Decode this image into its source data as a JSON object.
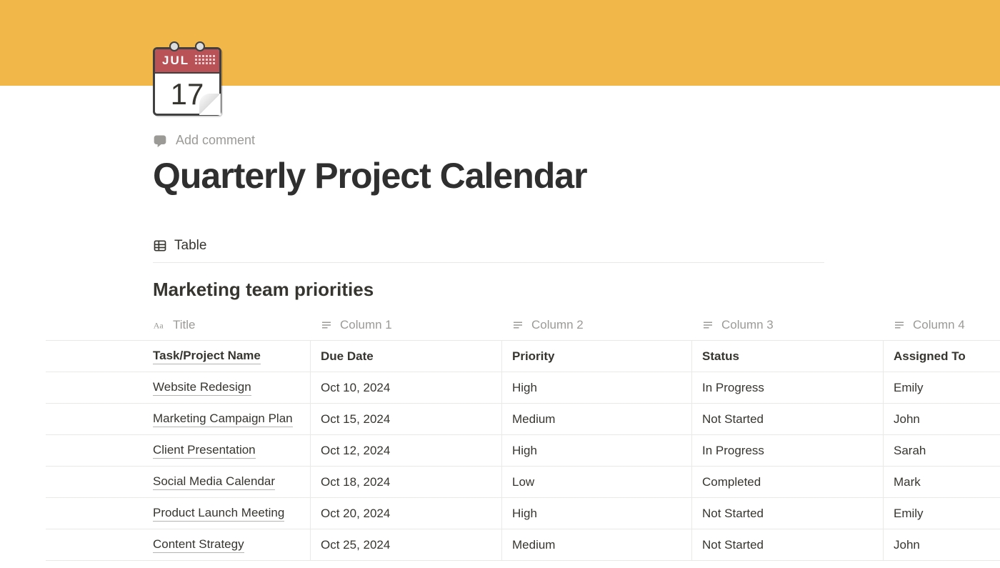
{
  "banner": {
    "color": "#f2b749"
  },
  "page_icon": {
    "month": "JUL",
    "day": "17"
  },
  "add_comment_label": "Add comment",
  "page_title": "Quarterly Project Calendar",
  "view": {
    "active_tab": "Table"
  },
  "database": {
    "title": "Marketing team priorities",
    "columns": [
      {
        "name": "Title",
        "type": "title"
      },
      {
        "name": "Column 1",
        "type": "text"
      },
      {
        "name": "Column 2",
        "type": "text"
      },
      {
        "name": "Column 3",
        "type": "text"
      },
      {
        "name": "Column 4",
        "type": "text"
      }
    ],
    "rows": [
      {
        "title": "Task/Project Name",
        "c1": "Due Date",
        "c2": "Priority",
        "c3": "Status",
        "c4": "Assigned To",
        "is_header_row": true
      },
      {
        "title": "Website Redesign",
        "c1": "Oct 10, 2024",
        "c2": "High",
        "c3": "In Progress",
        "c4": "Emily"
      },
      {
        "title": "Marketing Campaign Plan",
        "c1": "Oct 15, 2024",
        "c2": "Medium",
        "c3": "Not Started",
        "c4": "John"
      },
      {
        "title": "Client Presentation",
        "c1": "Oct 12, 2024",
        "c2": "High",
        "c3": "In Progress",
        "c4": "Sarah"
      },
      {
        "title": "Social Media Calendar",
        "c1": "Oct 18, 2024",
        "c2": "Low",
        "c3": "Completed",
        "c4": "Mark"
      },
      {
        "title": "Product Launch Meeting",
        "c1": "Oct 20, 2024",
        "c2": "High",
        "c3": "Not Started",
        "c4": "Emily"
      },
      {
        "title": "Content Strategy",
        "c1": "Oct 25, 2024",
        "c2": "Medium",
        "c3": "Not Started",
        "c4": "John"
      }
    ]
  }
}
